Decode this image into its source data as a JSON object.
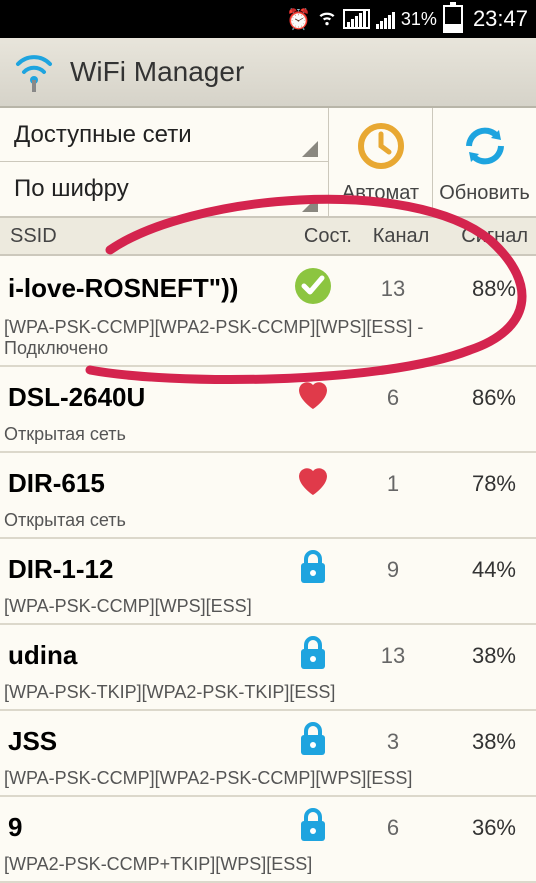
{
  "status_bar": {
    "battery_percent": "31%",
    "time": "23:47"
  },
  "app": {
    "title": "WiFi Manager"
  },
  "filters": {
    "available": "Доступные сети",
    "by_cipher": "По шифру"
  },
  "actions": {
    "auto": "Автомат",
    "refresh": "Обновить"
  },
  "columns": {
    "ssid": "SSID",
    "state": "Сост.",
    "channel": "Канал",
    "signal": "Сигнал"
  },
  "networks": [
    {
      "ssid": "i-love-ROSNEFT\"))",
      "state_icon": "check",
      "channel": "13",
      "signal": "88%",
      "detail": "[WPA-PSK-CCMP][WPA2-PSK-CCMP][WPS][ESS] - Подключено"
    },
    {
      "ssid": "DSL-2640U",
      "state_icon": "heart",
      "channel": "6",
      "signal": "86%",
      "detail": "Открытая сеть"
    },
    {
      "ssid": "DIR-615",
      "state_icon": "heart",
      "channel": "1",
      "signal": "78%",
      "detail": "Открытая сеть"
    },
    {
      "ssid": "DIR-1-12",
      "state_icon": "lock",
      "channel": "9",
      "signal": "44%",
      "detail": "[WPA-PSK-CCMP][WPS][ESS]"
    },
    {
      "ssid": "udina",
      "state_icon": "lock",
      "channel": "13",
      "signal": "38%",
      "detail": "[WPA-PSK-TKIP][WPA2-PSK-TKIP][ESS]"
    },
    {
      "ssid": "JSS",
      "state_icon": "lock",
      "channel": "3",
      "signal": "38%",
      "detail": "[WPA-PSK-CCMP][WPA2-PSK-CCMP][WPS][ESS]"
    },
    {
      "ssid": "9",
      "state_icon": "lock",
      "channel": "6",
      "signal": "36%",
      "detail": "[WPA2-PSK-CCMP+TKIP][WPS][ESS]"
    }
  ],
  "colors": {
    "accent_orange": "#e8a832",
    "accent_blue": "#1ea4df",
    "heart": "#e03a4a",
    "check_bg": "#8cc540",
    "annotation": "#d4244e"
  }
}
